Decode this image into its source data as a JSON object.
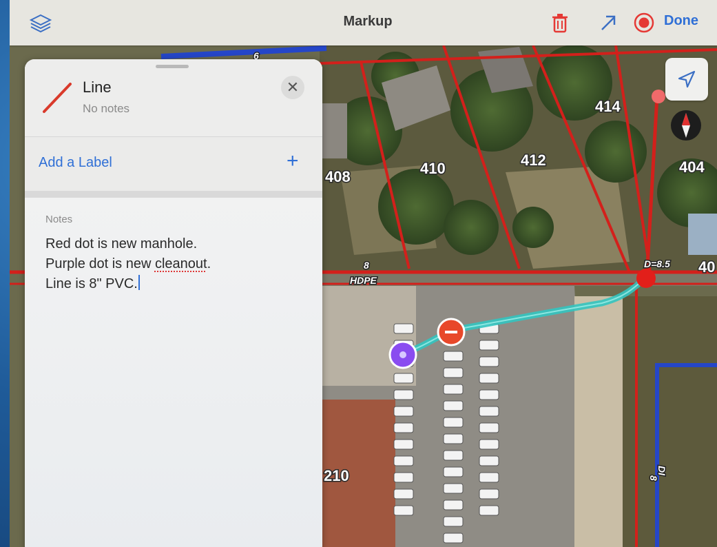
{
  "toolbar": {
    "title": "Markup",
    "done_label": "Done",
    "icons": [
      "layers-icon",
      "trash-icon",
      "arrow-icon",
      "record-icon"
    ],
    "accent": "#2f6fd6",
    "danger": "#e53935"
  },
  "panel": {
    "item_type": "Line",
    "item_subtitle": "No notes",
    "add_label": "Add a Label",
    "notes_label": "Notes",
    "notes_lines": [
      "Red dot is new manhole.",
      "Purple dot is new ",
      "cleanout",
      ".",
      "Line is 8\" PVC."
    ]
  },
  "map": {
    "lot_labels": [
      "414",
      "412",
      "410",
      "408",
      "404",
      "40",
      "210",
      "6"
    ],
    "pipe_label": "HDPE",
    "pipe_size": "8",
    "depth_label": "D=8.5",
    "right_line_label": "8",
    "right_line_label2": "DI",
    "manhole_color": "#e8482a",
    "cleanout_color": "#8a4cf0",
    "line_color": "#33c4c0",
    "parcel_color": "#d3201b",
    "boundary_color": "#2546c8"
  }
}
